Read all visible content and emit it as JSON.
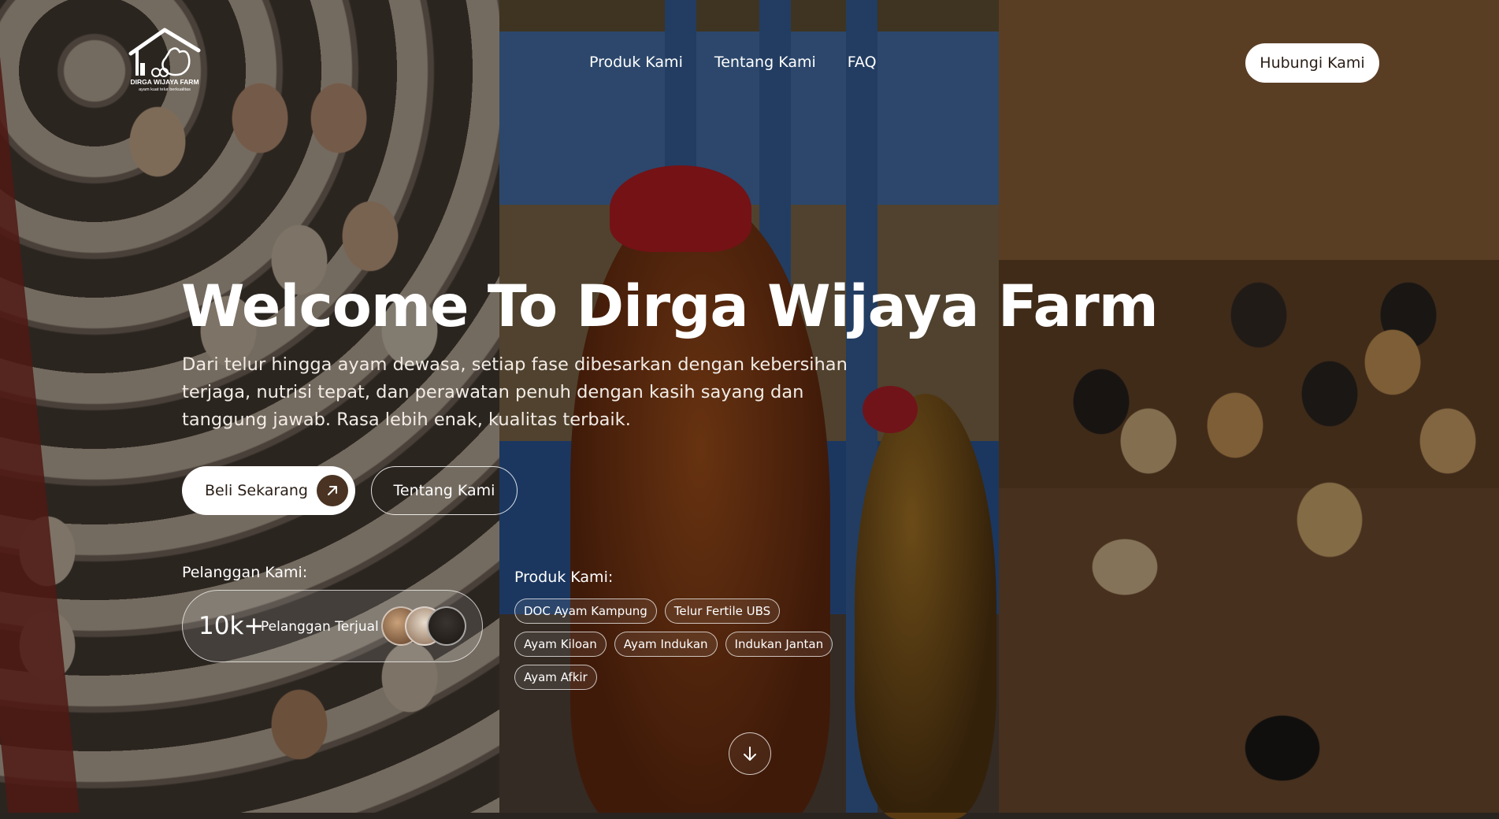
{
  "logo": {
    "name": "DIRGA WIJAYA FARM",
    "tagline": "ayam kuat telur berkualitas"
  },
  "nav": {
    "items": [
      {
        "label": "Produk Kami"
      },
      {
        "label": "Tentang Kami"
      },
      {
        "label": "FAQ"
      }
    ],
    "contact_label": "Hubungi Kami"
  },
  "hero": {
    "title": "Welcome To Dirga Wijaya Farm",
    "description": "Dari telur hingga ayam dewasa, setiap fase dibesarkan dengan kebersihan terjaga, nutrisi tepat, dan perawatan penuh dengan kasih sayang dan tanggung jawab. Rasa lebih enak, kualitas terbaik.",
    "primary_button": "Beli Sekarang",
    "secondary_button": "Tentang Kami"
  },
  "customers": {
    "label": "Pelanggan Kami:",
    "count": "10k+",
    "count_label": "Pelanggan Terjual"
  },
  "products": {
    "label": "Produk Kami:",
    "items": [
      "DOC Ayam Kampung",
      "Telur Fertile UBS",
      "Ayam Kiloan",
      "Ayam Indukan",
      "Indukan Jantan",
      "Ayam Afkir"
    ]
  },
  "icons": {
    "cta_arrow": "arrow-up-right-icon",
    "scroll": "arrow-down-icon",
    "logo": "farm-house-rooster-icon"
  },
  "colors": {
    "accent_dark": "#4a3322",
    "button_bg": "#ffffff",
    "text": "#ffffff"
  }
}
